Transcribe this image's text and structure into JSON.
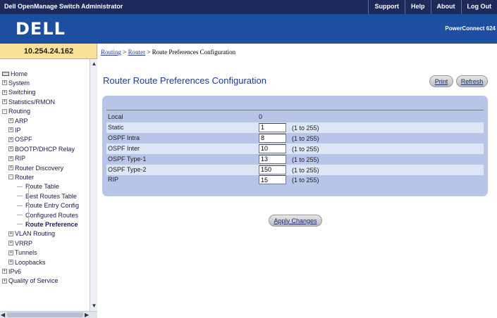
{
  "header": {
    "app_title": "Dell OpenManage Switch Administrator",
    "links": [
      "Support",
      "Help",
      "About",
      "Log Out"
    ],
    "logo": "DELL",
    "product": "PowerConnect 624"
  },
  "ip_address": "10.254.24.162",
  "breadcrumb": {
    "items": [
      "Routing",
      "Router"
    ],
    "separator": " > ",
    "current": "Route Preferences Configuration"
  },
  "sidebar": {
    "items": [
      {
        "label": "Home",
        "level": 0
      },
      {
        "label": "System",
        "level": 0,
        "expander": "+"
      },
      {
        "label": "Switching",
        "level": 0,
        "expander": "+"
      },
      {
        "label": "Statistics/RMON",
        "level": 0,
        "expander": "+"
      },
      {
        "label": "Routing",
        "level": 0,
        "expander": "-"
      },
      {
        "label": "ARP",
        "level": 1,
        "expander": "+"
      },
      {
        "label": "IP",
        "level": 1,
        "expander": "+"
      },
      {
        "label": "OSPF",
        "level": 1,
        "expander": "+"
      },
      {
        "label": "BOOTP/DHCP Relay",
        "level": 1,
        "expander": "+"
      },
      {
        "label": "RIP",
        "level": 1,
        "expander": "+"
      },
      {
        "label": "Router Discovery",
        "level": 1,
        "expander": "+"
      },
      {
        "label": "Router",
        "level": 1,
        "expander": "-"
      },
      {
        "label": "Route Table",
        "level": 2
      },
      {
        "label": "Best Routes Table",
        "level": 2
      },
      {
        "label": "Route Entry Config",
        "level": 2
      },
      {
        "label": "Configured Routes",
        "level": 2
      },
      {
        "label": "Route Preference",
        "level": 2,
        "selected": true
      },
      {
        "label": "VLAN Routing",
        "level": 1,
        "expander": "+"
      },
      {
        "label": "VRRP",
        "level": 1,
        "expander": "+"
      },
      {
        "label": "Tunnels",
        "level": 1,
        "expander": "+"
      },
      {
        "label": "Loopbacks",
        "level": 1,
        "expander": "+"
      },
      {
        "label": "IPv6",
        "level": 0,
        "expander": "+"
      },
      {
        "label": "Quality of Service",
        "level": 0,
        "expander": "+"
      }
    ]
  },
  "main": {
    "title": "Router Route Preferences Configuration",
    "print_label": "Print",
    "refresh_label": "Refresh",
    "apply_label": "Apply Changes",
    "rows": [
      {
        "label": "Local",
        "value": "0",
        "editable": false,
        "range": ""
      },
      {
        "label": "Static",
        "value": "1",
        "editable": true,
        "range": "(1 to 255)"
      },
      {
        "label": "OSPF Intra",
        "value": "8",
        "editable": true,
        "range": "(1 to 255)"
      },
      {
        "label": "OSPF Inter",
        "value": "10",
        "editable": true,
        "range": "(1 to 255)"
      },
      {
        "label": "OSPF Type-1",
        "value": "13",
        "editable": true,
        "range": "(1 to 255)"
      },
      {
        "label": "OSPF Type-2",
        "value": "150",
        "editable": true,
        "range": "(1 to 255)"
      },
      {
        "label": "RIP",
        "value": "15",
        "editable": true,
        "range": "(1 to 255)"
      }
    ]
  },
  "colors": {
    "top_bar": "#1e2a5a",
    "banner": "#1d4fa0",
    "ip_box": "#f9e19a",
    "panel": "#b6c5e8",
    "title_text": "#1d3f8a"
  }
}
